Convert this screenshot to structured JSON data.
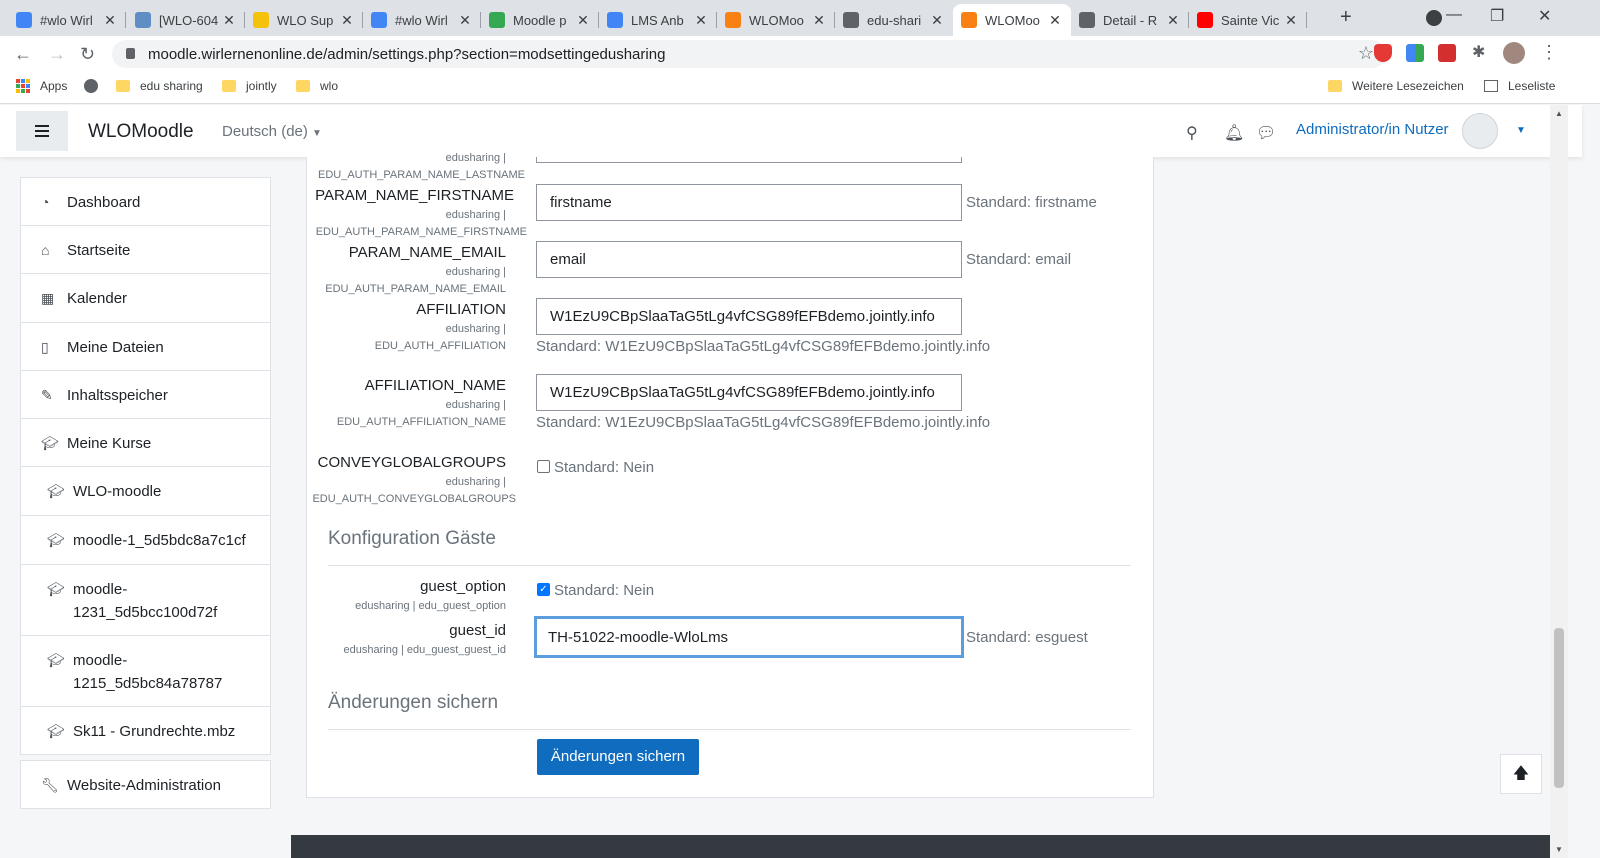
{
  "browser": {
    "tabs": [
      {
        "title": "#wlo Wirl",
        "color": "#4285f4"
      },
      {
        "title": "[WLO-604",
        "color": "#5f8dc4"
      },
      {
        "title": "WLO Sup",
        "color": "#f4c20d"
      },
      {
        "title": "#wlo Wirl",
        "color": "#4285f4"
      },
      {
        "title": "Moodle p",
        "color": "#34a853"
      },
      {
        "title": "LMS Anb",
        "color": "#4285f4"
      },
      {
        "title": "WLOMoo",
        "color": "#f98012"
      },
      {
        "title": "edu-shari",
        "color": "#5f6368"
      },
      {
        "title": "WLOMoo",
        "color": "#f98012"
      },
      {
        "title": "Detail - R",
        "color": "#5f6368"
      },
      {
        "title": "Sainte Vic",
        "color": "#ff0000"
      }
    ],
    "url": "moodle.wirlernenonline.de/admin/settings.php?section=modsettingedusharing",
    "bookmarks": [
      "Apps",
      "edu sharing",
      "jointly",
      "wlo"
    ],
    "bookmarks_right": [
      "Weitere Lesezeichen",
      "Leseliste"
    ]
  },
  "navbar": {
    "brand": "WLOMoodle",
    "language": "Deutsch (de)",
    "user": "Administrator/in Nutzer"
  },
  "sidebar": {
    "items": [
      {
        "label": "Dashboard",
        "icon": "dashboard-icon"
      },
      {
        "label": "Startseite",
        "icon": "home-icon"
      },
      {
        "label": "Kalender",
        "icon": "calendar-icon"
      },
      {
        "label": "Meine Dateien",
        "icon": "file-icon"
      },
      {
        "label": "Inhaltsspeicher",
        "icon": "brush-icon"
      },
      {
        "label": "Meine Kurse",
        "icon": "graduation-cap-icon"
      },
      {
        "label": "WLO-moodle",
        "icon": "graduation-cap-icon"
      },
      {
        "label": "moodle-1_5d5bdc8a7c1cf",
        "icon": "graduation-cap-icon"
      },
      {
        "label": "moodle-",
        "label2": "1231_5d5bcc100d72f",
        "icon": "graduation-cap-icon"
      },
      {
        "label": "moodle-",
        "label2": "1215_5d5bc84a78787",
        "icon": "graduation-cap-icon"
      },
      {
        "label": "Sk11 - Grundrechte.mbz",
        "icon": "graduation-cap-icon"
      }
    ],
    "admin": "Website-Administration"
  },
  "settings": {
    "lastname_sub_a": "edusharing |",
    "lastname_sub_b": "EDU_AUTH_PARAM_NAME_LASTNAME",
    "firstname": {
      "title": "PARAM_NAME_FIRSTNAME",
      "sub_a": "edusharing |",
      "sub_b": "EDU_AUTH_PARAM_NAME_FIRSTNAME",
      "value": "firstname",
      "default": "Standard: firstname"
    },
    "email": {
      "title": "PARAM_NAME_EMAIL",
      "sub_a": "edusharing |",
      "sub_b": "EDU_AUTH_PARAM_NAME_EMAIL",
      "value": "email",
      "default": "Standard: email"
    },
    "affiliation": {
      "title": "AFFILIATION",
      "sub_a": "edusharing |",
      "sub_b": "EDU_AUTH_AFFILIATION",
      "value": "W1EzU9CBpSlaaTaG5tLg4vfCSG89fEFBdemo.jointly.info",
      "default": "Standard: W1EzU9CBpSlaaTaG5tLg4vfCSG89fEFBdemo.jointly.info"
    },
    "affiliation_name": {
      "title": "AFFILIATION_NAME",
      "sub_a": "edusharing |",
      "sub_b": "EDU_AUTH_AFFILIATION_NAME",
      "value": "W1EzU9CBpSlaaTaG5tLg4vfCSG89fEFBdemo.jointly.info",
      "default": "Standard: W1EzU9CBpSlaaTaG5tLg4vfCSG89fEFBdemo.jointly.info"
    },
    "conveyglobalgroups": {
      "title": "CONVEYGLOBALGROUPS",
      "sub_a": "edusharing |",
      "sub_b": "EDU_AUTH_CONVEYGLOBALGROUPS",
      "checked": false,
      "default": "Standard: Nein"
    },
    "guest_section": "Konfiguration Gäste",
    "guest_option": {
      "title": "guest_option",
      "sub": "edusharing | edu_guest_option",
      "checked": true,
      "default": "Standard: Nein"
    },
    "guest_id": {
      "title": "guest_id",
      "sub": "edusharing | edu_guest_guest_id",
      "value": "TH-51022-moodle-WloLms",
      "default": "Standard: esguest"
    },
    "save_section": "Änderungen sichern",
    "save_button": "Änderungen sichern"
  }
}
